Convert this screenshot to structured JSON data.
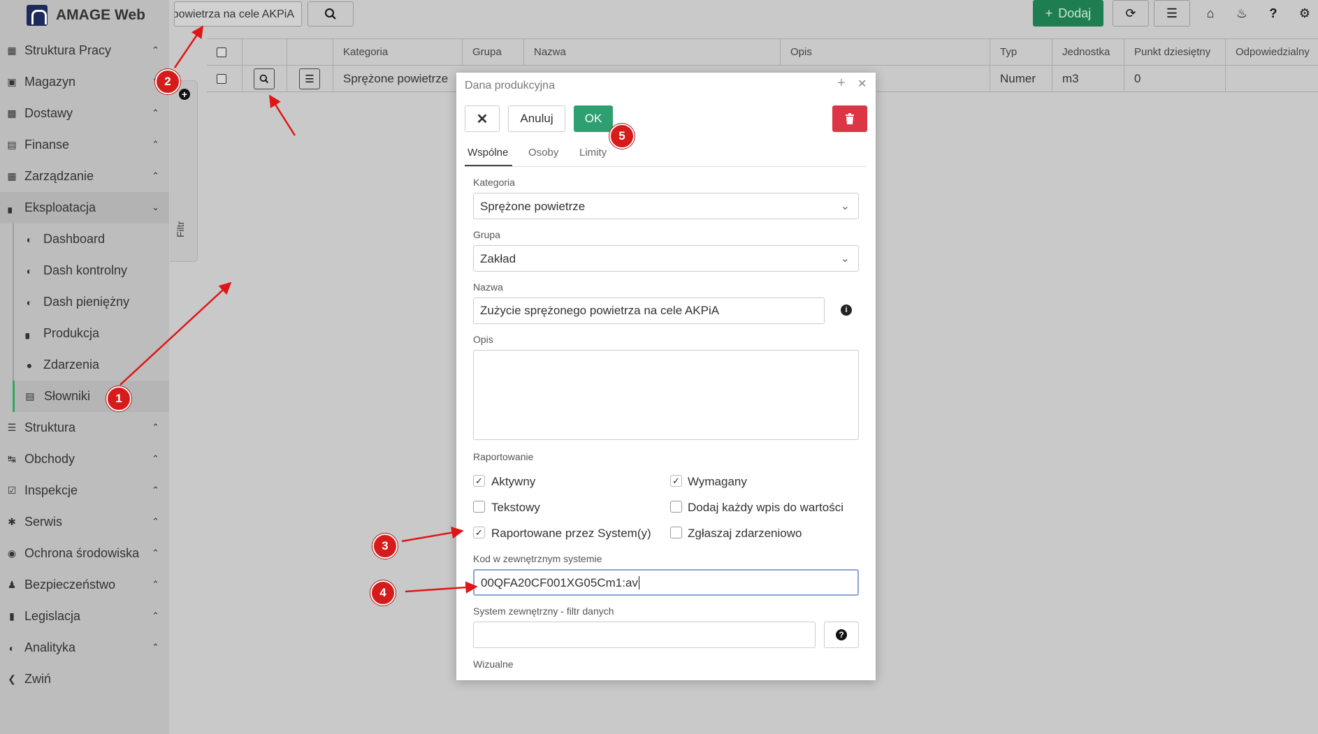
{
  "app": {
    "title": "AMAGE Web"
  },
  "sidebar": {
    "items": [
      {
        "label": "Struktura Pracy",
        "icon": "building-icon"
      },
      {
        "label": "Magazyn",
        "icon": "warehouse-icon"
      },
      {
        "label": "Dostawy",
        "icon": "truck-icon"
      },
      {
        "label": "Finanse",
        "icon": "money-icon"
      },
      {
        "label": "Zarządzanie",
        "icon": "building-icon"
      },
      {
        "label": "Eksploatacja",
        "icon": "industry-icon"
      }
    ],
    "sub_items": [
      {
        "label": "Dashboard",
        "icon": "gauge-icon"
      },
      {
        "label": "Dash kontrolny",
        "icon": "gauge-icon"
      },
      {
        "label": "Dash pieniężny",
        "icon": "gauge-icon"
      },
      {
        "label": "Produkcja",
        "icon": "industry-icon"
      },
      {
        "label": "Zdarzenia",
        "icon": "exclamation-icon"
      },
      {
        "label": "Słowniki",
        "icon": "list-icon"
      }
    ],
    "items_after": [
      {
        "label": "Struktura",
        "icon": "structure-icon"
      },
      {
        "label": "Obchody",
        "icon": "route-icon"
      },
      {
        "label": "Inspekcje",
        "icon": "checkbox-icon"
      },
      {
        "label": "Serwis",
        "icon": "bug-icon"
      },
      {
        "label": "Ochrona środowiska",
        "icon": "globe-icon"
      },
      {
        "label": "Bezpieczeństwo",
        "icon": "user-shield-icon"
      },
      {
        "label": "Legislacja",
        "icon": "book-icon"
      },
      {
        "label": "Analityka",
        "icon": "gauge-icon"
      }
    ],
    "collapse_label": "Zwiń",
    "filter_label": "Filtr"
  },
  "topbar": {
    "search_value": "Zużycie sprężonego powietrza na cele AKPiA",
    "add_label": "Dodaj"
  },
  "table": {
    "headers": [
      "Kategoria",
      "Grupa",
      "Nazwa",
      "Opis",
      "Typ",
      "Jednostka",
      "Punkt dziesiętny",
      "Odpowiedzialny"
    ],
    "row": {
      "kategoria": "Sprężone powietrze",
      "typ": "Numer",
      "jednostka": "m3",
      "punkt": "0"
    }
  },
  "dialog": {
    "title": "Dana produkcyjna",
    "cancel_label": "Anuluj",
    "ok_label": "OK",
    "tabs": [
      "Wspólne",
      "Osoby",
      "Limity"
    ],
    "fields": {
      "kategoria_label": "Kategoria",
      "kategoria_value": "Sprężone powietrze",
      "grupa_label": "Grupa",
      "grupa_value": "Zakład",
      "nazwa_label": "Nazwa",
      "nazwa_value": "Zużycie sprężonego powietrza na cele AKPiA",
      "opis_label": "Opis",
      "raportowanie_label": "Raportowanie",
      "kod_label": "Kod w zewnętrznym systemie",
      "kod_value": "00QFA20CF001XG05Cm1:av",
      "filtr_label": "System zewnętrzny - filtr danych",
      "wizualne_label": "Wizualne"
    },
    "checkboxes": [
      {
        "label": "Aktywny",
        "checked": true
      },
      {
        "label": "Wymagany",
        "checked": true
      },
      {
        "label": "Tekstowy",
        "checked": false
      },
      {
        "label": "Dodaj każdy wpis do wartości",
        "checked": false
      },
      {
        "label": "Raportowane przez System(y)",
        "checked": true
      },
      {
        "label": "Zgłaszaj zdarzeniowo",
        "checked": false
      }
    ]
  },
  "annotations": {
    "badges": [
      "1",
      "2",
      "3",
      "4",
      "5"
    ]
  },
  "colors": {
    "ok": "#2ea070",
    "add": "#1e7e52",
    "delete": "#dc3545",
    "annotation": "#d71a1a",
    "active_nav": "#2ea85a"
  }
}
